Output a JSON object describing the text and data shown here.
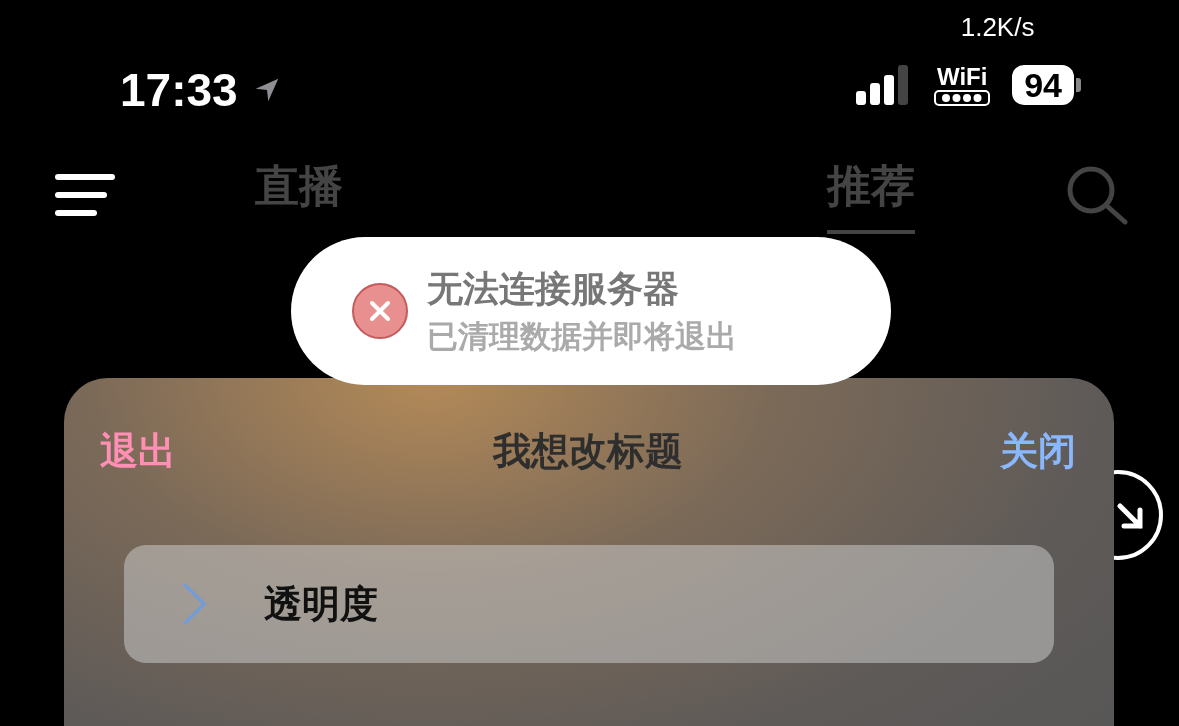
{
  "status_bar": {
    "time": "17:33",
    "net_speed": "1.2K/s",
    "wifi_label": "WiFi",
    "battery": "94"
  },
  "nav": {
    "tabs": [
      {
        "label": "直播",
        "selected": false
      },
      {
        "label": "推荐",
        "selected": true
      }
    ]
  },
  "toast": {
    "kind": "error",
    "title": "无法连接服务器",
    "message": "已清理数据并即将退出"
  },
  "sheet": {
    "left_action": "退出",
    "title": "我想改标题",
    "right_action": "关闭",
    "rows": [
      {
        "label": "透明度",
        "expanded": false
      }
    ]
  }
}
